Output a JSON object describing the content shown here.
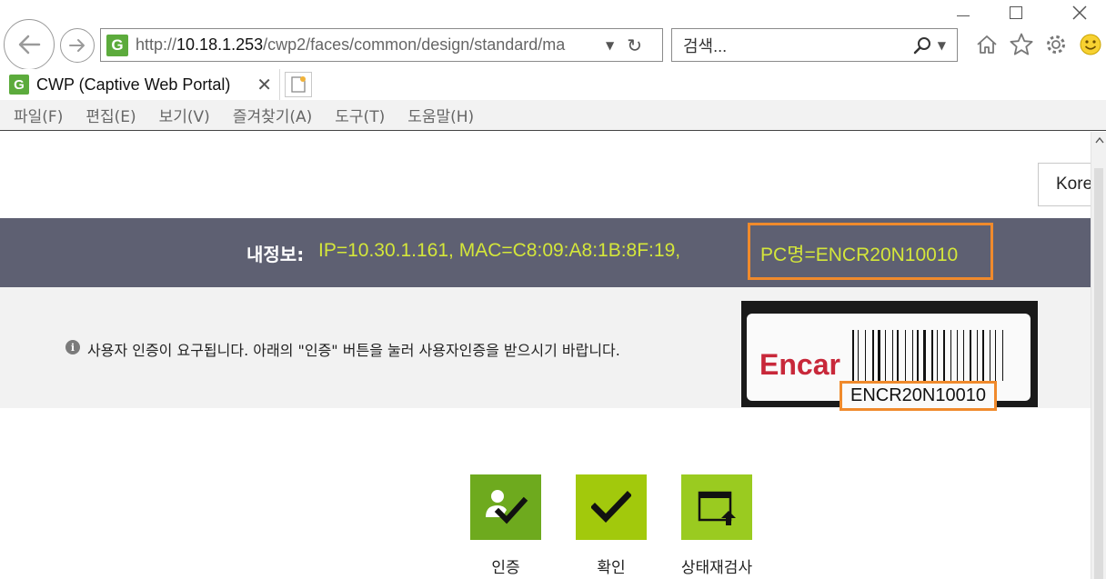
{
  "browser": {
    "address": {
      "prefix": "http://",
      "host": "10.18.1.253",
      "path": "/cwp2/faces/common/design/standard/ma"
    },
    "search": {
      "placeholder": "검색..."
    },
    "tab": {
      "title": "CWP (Captive Web Portal)"
    },
    "site_logo_letter": "G",
    "menu": [
      "파일(F)",
      "편집(E)",
      "보기(V)",
      "즐겨찾기(A)",
      "도구(T)",
      "도움말(H)"
    ],
    "toolbar_icons": [
      "home-icon",
      "favorites-star-icon",
      "settings-gear-icon",
      "feedback-smiley-icon"
    ]
  },
  "page": {
    "language_button": "Kore",
    "info": {
      "label": "내정보:",
      "ip_mac": "IP=10.30.1.161,   MAC=C8:09:A8:1B:8F:19,",
      "pc_name": "PC명=ENCR20N10010"
    },
    "notice": "사용자 인증이 요구됩니다. 아래의 \"인증\" 버튼을 눌러 사용자인증을 받으시기 바랍니다.",
    "label_photo": {
      "brand": "Encar",
      "serial": "ENCR20N10010"
    },
    "actions": [
      {
        "label": "인증",
        "icon": "user-check-icon"
      },
      {
        "label": "확인",
        "icon": "checkmark-icon"
      },
      {
        "label": "상태재검사",
        "icon": "window-upload-icon"
      }
    ]
  },
  "colors": {
    "info_band": "#5e6072",
    "info_text": "#d4e63a",
    "highlight": "#f08a2c",
    "auth_button": "#6eaa1e",
    "ok_button": "#a2c90c",
    "recheck_button": "#9acb20",
    "brand_red": "#c8283a"
  }
}
